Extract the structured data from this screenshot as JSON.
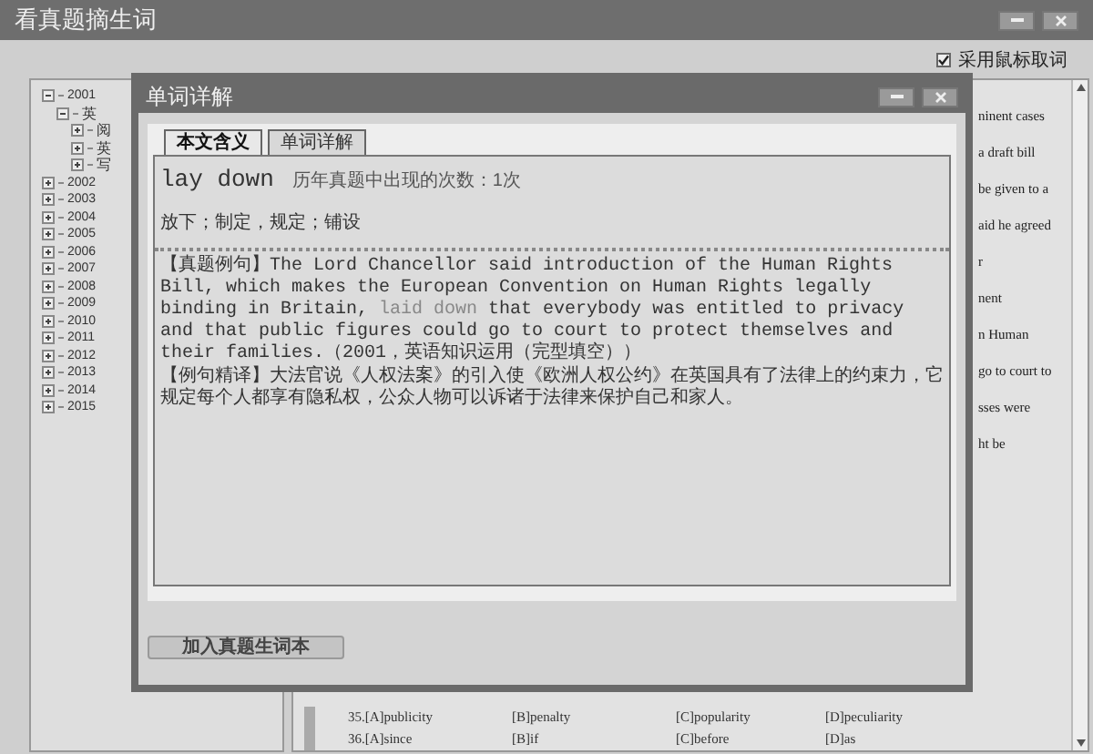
{
  "window": {
    "title": "看真题摘生词"
  },
  "mouse_pick": {
    "label": "采用鼠标取词",
    "checked": true
  },
  "tree": [
    {
      "label": "2001",
      "expanded": true,
      "children": [
        {
          "label": "英",
          "expanded": true,
          "children": [
            {
              "label": "阅",
              "expanded": false
            },
            {
              "label": "英",
              "expanded": false
            },
            {
              "label": "写",
              "expanded": false
            }
          ]
        }
      ]
    },
    {
      "label": "2002",
      "expanded": false
    },
    {
      "label": "2003",
      "expanded": false
    },
    {
      "label": "2004",
      "expanded": false
    },
    {
      "label": "2005",
      "expanded": false
    },
    {
      "label": "2006",
      "expanded": false
    },
    {
      "label": "2007",
      "expanded": false
    },
    {
      "label": "2008",
      "expanded": false
    },
    {
      "label": "2009",
      "expanded": false
    },
    {
      "label": "2010",
      "expanded": false
    },
    {
      "label": "2011",
      "expanded": false
    },
    {
      "label": "2012",
      "expanded": false
    },
    {
      "label": "2013",
      "expanded": false
    },
    {
      "label": "2014",
      "expanded": false
    },
    {
      "label": "2015",
      "expanded": false
    }
  ],
  "passage_fragments": [
    "ninent cases",
    "a draft bill",
    "be given to a",
    "aid he agreed",
    "r",
    "nent",
    "n Human",
    "go to court to",
    "sses were",
    "ht be"
  ],
  "options": [
    [
      "35.[A]publicity",
      "[B]penalty",
      "[C]popularity",
      "[D]peculiarity"
    ],
    [
      "36.[A]since",
      "[B]if",
      "[C]before",
      "[D]as"
    ]
  ],
  "dialog": {
    "title": "单词详解",
    "tabs": [
      {
        "label": "本文含义",
        "selected": true
      },
      {
        "label": "单词详解",
        "selected": false
      }
    ],
    "word": "lay down",
    "count": "历年真题中出现的次数：1次",
    "meaning": "放下；制定，规定；铺设",
    "example": "【真题例句】The Lord Chancellor said introduction of the Human Rights Bill, which makes the European Convention on Human Rights legally binding in Britain, ",
    "example_highlight": "laid down",
    "example_rest": " that everybody was entitled to privacy and that public figures could go to court to protect themselves and their families.（2001，英语知识运用（完型填空））",
    "translation": "【例句精译】大法官说《人权法案》的引入使《欧洲人权公约》在英国具有了法律上的约束力，它规定每个人都享有隐私权，公众人物可以诉诸于法律来保护自己和家人。",
    "add_button": "加入真题生词本"
  }
}
